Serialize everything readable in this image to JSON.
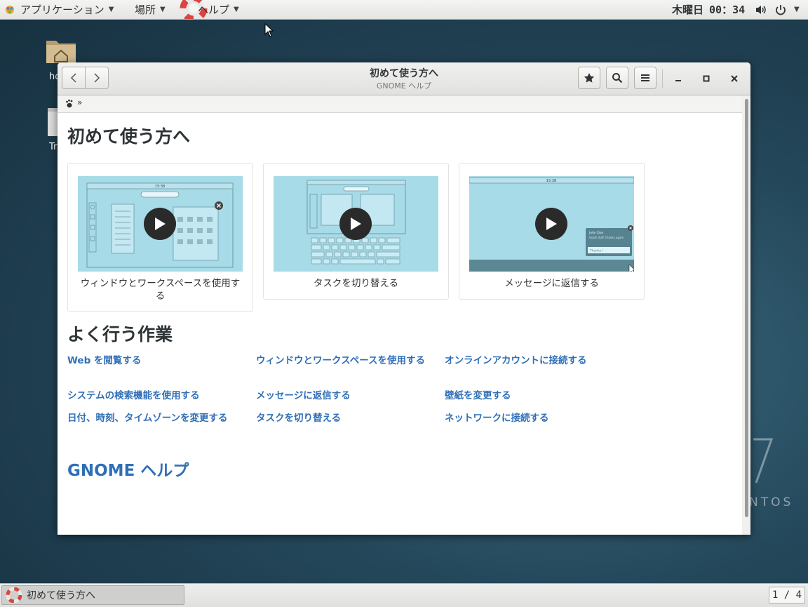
{
  "topbar": {
    "applications": "アプリケーション",
    "places": "場所",
    "help": "ヘルプ",
    "clock_day": "木曜日",
    "clock_time": "00：34"
  },
  "desktop": {
    "home_label": "ho",
    "trash_label": "Tr",
    "brand_text": "NTOS"
  },
  "window": {
    "title": "初めて使う方へ",
    "subtitle": "GNOME ヘルプ",
    "breadcrumb_sep": "»"
  },
  "content": {
    "heading": "初めて使う方へ",
    "cards": [
      {
        "label": "ウィンドウとワークスペースを使用する"
      },
      {
        "label": "タスクを切り替える"
      },
      {
        "label": "メッセージに返信する"
      }
    ],
    "thumb_notify": {
      "name": "John Doe",
      "msg": "Good stuff, thanks again",
      "reply": "Thanks !"
    },
    "thumb_clock": "15:38",
    "common_heading": "よく行う作業",
    "tasks": [
      [
        "Web を閲覧する",
        "ウィンドウとワークスペースを使用する",
        "オンラインアカウントに接続する"
      ],
      [
        "システムの検索機能を使用する",
        "メッセージに返信する",
        "壁紙を変更する"
      ],
      [
        "日付、時刻、タイムゾーンを変更する",
        "タスクを切り替える",
        "ネットワークに接続する"
      ]
    ],
    "gnome_help": "GNOME ヘルプ"
  },
  "bottombar": {
    "task_label": "初めて使う方へ",
    "workspace": "1 / 4"
  },
  "colors": {
    "link": "#2f6fb7",
    "thumb_bg": "#a7dbe8"
  }
}
